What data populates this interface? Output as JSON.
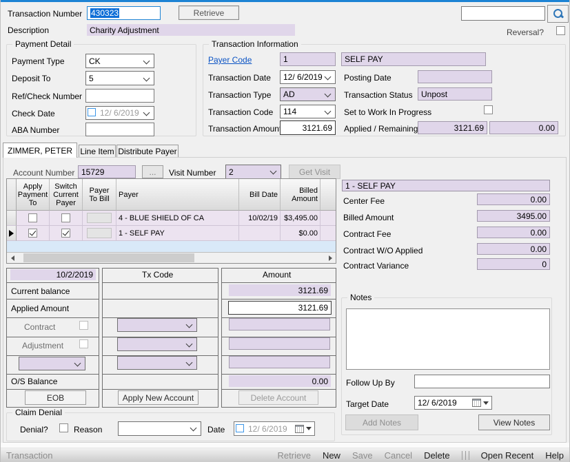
{
  "colors": {
    "accent_lavender": "#e0d6ea",
    "row_lavender": "#ece3f0",
    "selection_blue": "#0f6fd7",
    "light_blue_area": "#d9e9f8",
    "link_blue": "#0a53c4",
    "top_strip": "#1d83d4"
  },
  "icons": {
    "search": "magnifier-icon",
    "calendar": "calendar-icon",
    "chevron": "chevron-down",
    "current_row_marker": "right-arrow",
    "scroll_left": "left-triangle",
    "scroll_right": "right-triangle"
  },
  "header": {
    "transaction_number_label": "Transaction Number",
    "transaction_number_value": "430323",
    "retrieve_button": "Retrieve",
    "description_label": "Description",
    "description_value": "Charity Adjustment",
    "search_value": "",
    "reversal_label": "Reversal?"
  },
  "payment_detail": {
    "title": "Payment Detail",
    "payment_type_label": "Payment Type",
    "payment_type_value": "CK",
    "deposit_to_label": "Deposit To",
    "deposit_to_value": "5",
    "ref_check_label": "Ref/Check Number",
    "ref_check_value": "",
    "check_date_label": "Check Date",
    "check_date_value": "12/ 6/2019",
    "aba_label": "ABA Number",
    "aba_value": ""
  },
  "transaction_info": {
    "title": "Transaction Information",
    "payer_code_label": "Payer Code",
    "payer_code_value": "1",
    "payer_name": "SELF PAY",
    "transaction_date_label": "Transaction Date",
    "transaction_date_value": "12/ 6/2019",
    "posting_date_label": "Posting Date",
    "posting_date_value": "",
    "transaction_type_label": "Transaction Type",
    "transaction_type_value": "AD",
    "transaction_status_label": "Transaction Status",
    "transaction_status_value": "Unpost",
    "transaction_code_label": "Transaction Code",
    "transaction_code_value": "114",
    "wip_label": "Set to Work In Progress",
    "transaction_amount_label": "Transaction Amount",
    "transaction_amount_value": "3121.69",
    "applied_remaining_label": "Applied / Remaining",
    "applied_value": "3121.69",
    "remaining_value": "0.00"
  },
  "tabs": [
    {
      "label": "ZIMMER, PETER",
      "active": true
    },
    {
      "label": "Line Item",
      "active": false
    },
    {
      "label": "Distribute Payer",
      "active": false
    }
  ],
  "account": {
    "account_number_label": "Account Number",
    "account_number_value": "15729",
    "browse_button": "...",
    "visit_number_label": "Visit Number",
    "visit_number_value": "2",
    "get_visit_button": "Get Visit"
  },
  "payer_grid": {
    "columns": [
      "Apply Payment To",
      "Switch Current Payer",
      "Payer To Bill",
      "Payer",
      "Bill Date",
      "Billed Amount"
    ],
    "rows": [
      {
        "apply_checked": false,
        "switch_checked": false,
        "payer": "4 - BLUE SHIELD OF CA",
        "bill_date": "10/02/19",
        "billed_amount": "$3,495.00",
        "current": false
      },
      {
        "apply_checked": true,
        "switch_checked": true,
        "payer": "1 - SELF PAY",
        "bill_date": "",
        "billed_amount": "$0.00",
        "current": true
      }
    ]
  },
  "payer_summary": {
    "title": "1 - SELF PAY",
    "fields": [
      {
        "label": "Center Fee",
        "value": "0.00"
      },
      {
        "label": "Billed Amount",
        "value": "3495.00"
      },
      {
        "label": "Contract Fee",
        "value": "0.00"
      },
      {
        "label": "Contract W/O Applied",
        "value": "0.00"
      },
      {
        "label": "Contract Variance",
        "value": "0"
      }
    ]
  },
  "apply_grid": {
    "date_header": "10/2/2019",
    "tx_code_header": "Tx Code",
    "amount_header": "Amount",
    "current_balance_label": "Current balance",
    "current_balance_value": "3121.69",
    "applied_amount_label": "Applied Amount",
    "applied_amount_value": "3121.69",
    "contract_label": "Contract",
    "adjustment_label": "Adjustment",
    "os_balance_label": "O/S Balance",
    "os_balance_value": "0.00",
    "eob_button": "EOB",
    "apply_new_account_button": "Apply New Account",
    "delete_account_button": "Delete Account"
  },
  "claim_denial": {
    "title": "Claim Denial",
    "denial_label": "Denial?",
    "reason_label": "Reason",
    "date_label": "Date",
    "date_value": "12/ 6/2019"
  },
  "notes": {
    "title": "Notes",
    "text": "",
    "follow_up_label": "Follow Up By",
    "follow_up_value": "",
    "target_date_label": "Target Date",
    "target_date_value": "12/ 6/2019",
    "add_notes_button": "Add Notes",
    "view_notes_button": "View Notes"
  },
  "statusbar": {
    "mode": "Transaction",
    "actions": [
      {
        "label": "Retrieve",
        "enabled": false
      },
      {
        "label": "New",
        "enabled": true
      },
      {
        "label": "Save",
        "enabled": false
      },
      {
        "label": "Cancel",
        "enabled": false
      },
      {
        "label": "Delete",
        "enabled": true
      },
      {
        "label": "Open Recent",
        "enabled": true
      },
      {
        "label": "Help",
        "enabled": true
      }
    ]
  }
}
